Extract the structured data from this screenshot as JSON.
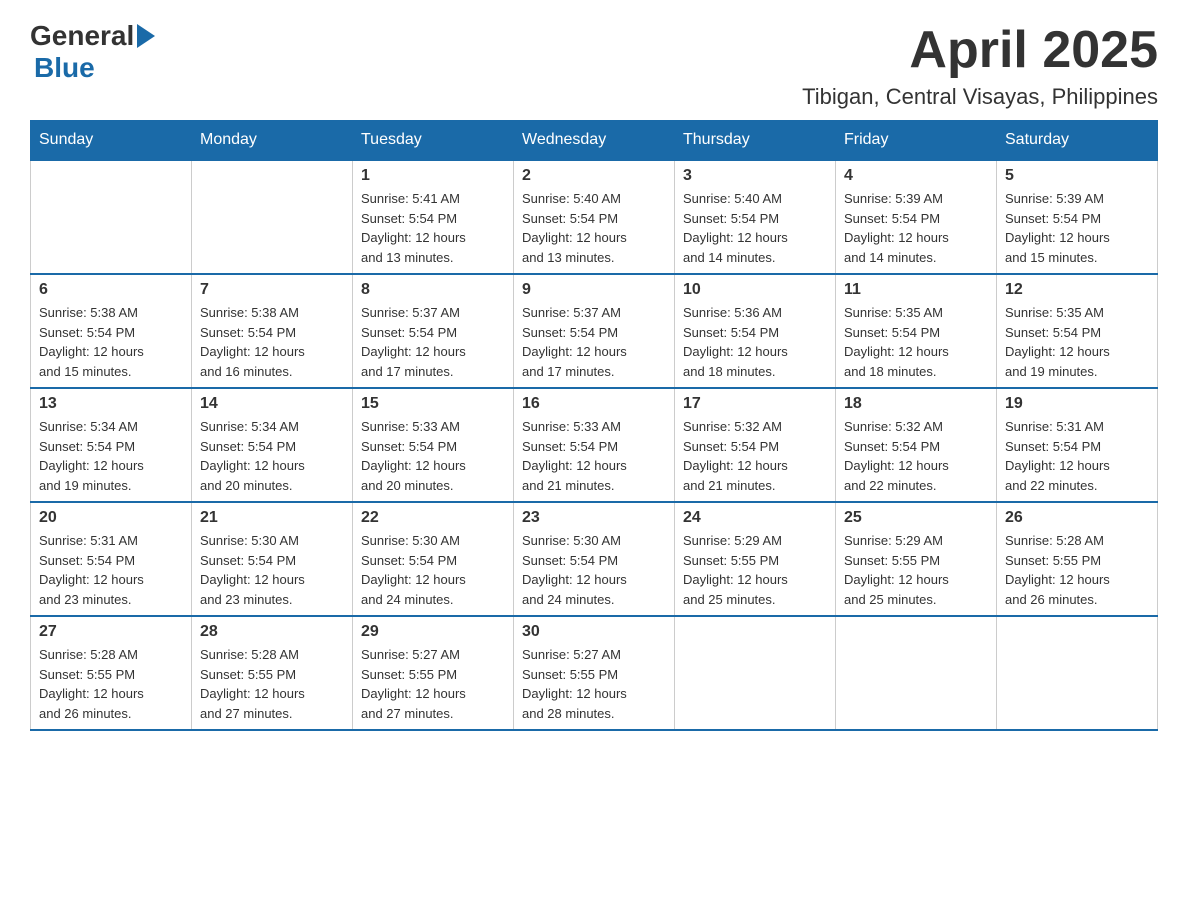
{
  "header": {
    "logo_general": "General",
    "logo_blue": "Blue",
    "month_title": "April 2025",
    "location": "Tibigan, Central Visayas, Philippines"
  },
  "weekdays": [
    "Sunday",
    "Monday",
    "Tuesday",
    "Wednesday",
    "Thursday",
    "Friday",
    "Saturday"
  ],
  "weeks": [
    [
      {
        "day": "",
        "info": ""
      },
      {
        "day": "",
        "info": ""
      },
      {
        "day": "1",
        "info": "Sunrise: 5:41 AM\nSunset: 5:54 PM\nDaylight: 12 hours\nand 13 minutes."
      },
      {
        "day": "2",
        "info": "Sunrise: 5:40 AM\nSunset: 5:54 PM\nDaylight: 12 hours\nand 13 minutes."
      },
      {
        "day": "3",
        "info": "Sunrise: 5:40 AM\nSunset: 5:54 PM\nDaylight: 12 hours\nand 14 minutes."
      },
      {
        "day": "4",
        "info": "Sunrise: 5:39 AM\nSunset: 5:54 PM\nDaylight: 12 hours\nand 14 minutes."
      },
      {
        "day": "5",
        "info": "Sunrise: 5:39 AM\nSunset: 5:54 PM\nDaylight: 12 hours\nand 15 minutes."
      }
    ],
    [
      {
        "day": "6",
        "info": "Sunrise: 5:38 AM\nSunset: 5:54 PM\nDaylight: 12 hours\nand 15 minutes."
      },
      {
        "day": "7",
        "info": "Sunrise: 5:38 AM\nSunset: 5:54 PM\nDaylight: 12 hours\nand 16 minutes."
      },
      {
        "day": "8",
        "info": "Sunrise: 5:37 AM\nSunset: 5:54 PM\nDaylight: 12 hours\nand 17 minutes."
      },
      {
        "day": "9",
        "info": "Sunrise: 5:37 AM\nSunset: 5:54 PM\nDaylight: 12 hours\nand 17 minutes."
      },
      {
        "day": "10",
        "info": "Sunrise: 5:36 AM\nSunset: 5:54 PM\nDaylight: 12 hours\nand 18 minutes."
      },
      {
        "day": "11",
        "info": "Sunrise: 5:35 AM\nSunset: 5:54 PM\nDaylight: 12 hours\nand 18 minutes."
      },
      {
        "day": "12",
        "info": "Sunrise: 5:35 AM\nSunset: 5:54 PM\nDaylight: 12 hours\nand 19 minutes."
      }
    ],
    [
      {
        "day": "13",
        "info": "Sunrise: 5:34 AM\nSunset: 5:54 PM\nDaylight: 12 hours\nand 19 minutes."
      },
      {
        "day": "14",
        "info": "Sunrise: 5:34 AM\nSunset: 5:54 PM\nDaylight: 12 hours\nand 20 minutes."
      },
      {
        "day": "15",
        "info": "Sunrise: 5:33 AM\nSunset: 5:54 PM\nDaylight: 12 hours\nand 20 minutes."
      },
      {
        "day": "16",
        "info": "Sunrise: 5:33 AM\nSunset: 5:54 PM\nDaylight: 12 hours\nand 21 minutes."
      },
      {
        "day": "17",
        "info": "Sunrise: 5:32 AM\nSunset: 5:54 PM\nDaylight: 12 hours\nand 21 minutes."
      },
      {
        "day": "18",
        "info": "Sunrise: 5:32 AM\nSunset: 5:54 PM\nDaylight: 12 hours\nand 22 minutes."
      },
      {
        "day": "19",
        "info": "Sunrise: 5:31 AM\nSunset: 5:54 PM\nDaylight: 12 hours\nand 22 minutes."
      }
    ],
    [
      {
        "day": "20",
        "info": "Sunrise: 5:31 AM\nSunset: 5:54 PM\nDaylight: 12 hours\nand 23 minutes."
      },
      {
        "day": "21",
        "info": "Sunrise: 5:30 AM\nSunset: 5:54 PM\nDaylight: 12 hours\nand 23 minutes."
      },
      {
        "day": "22",
        "info": "Sunrise: 5:30 AM\nSunset: 5:54 PM\nDaylight: 12 hours\nand 24 minutes."
      },
      {
        "day": "23",
        "info": "Sunrise: 5:30 AM\nSunset: 5:54 PM\nDaylight: 12 hours\nand 24 minutes."
      },
      {
        "day": "24",
        "info": "Sunrise: 5:29 AM\nSunset: 5:55 PM\nDaylight: 12 hours\nand 25 minutes."
      },
      {
        "day": "25",
        "info": "Sunrise: 5:29 AM\nSunset: 5:55 PM\nDaylight: 12 hours\nand 25 minutes."
      },
      {
        "day": "26",
        "info": "Sunrise: 5:28 AM\nSunset: 5:55 PM\nDaylight: 12 hours\nand 26 minutes."
      }
    ],
    [
      {
        "day": "27",
        "info": "Sunrise: 5:28 AM\nSunset: 5:55 PM\nDaylight: 12 hours\nand 26 minutes."
      },
      {
        "day": "28",
        "info": "Sunrise: 5:28 AM\nSunset: 5:55 PM\nDaylight: 12 hours\nand 27 minutes."
      },
      {
        "day": "29",
        "info": "Sunrise: 5:27 AM\nSunset: 5:55 PM\nDaylight: 12 hours\nand 27 minutes."
      },
      {
        "day": "30",
        "info": "Sunrise: 5:27 AM\nSunset: 5:55 PM\nDaylight: 12 hours\nand 28 minutes."
      },
      {
        "day": "",
        "info": ""
      },
      {
        "day": "",
        "info": ""
      },
      {
        "day": "",
        "info": ""
      }
    ]
  ]
}
